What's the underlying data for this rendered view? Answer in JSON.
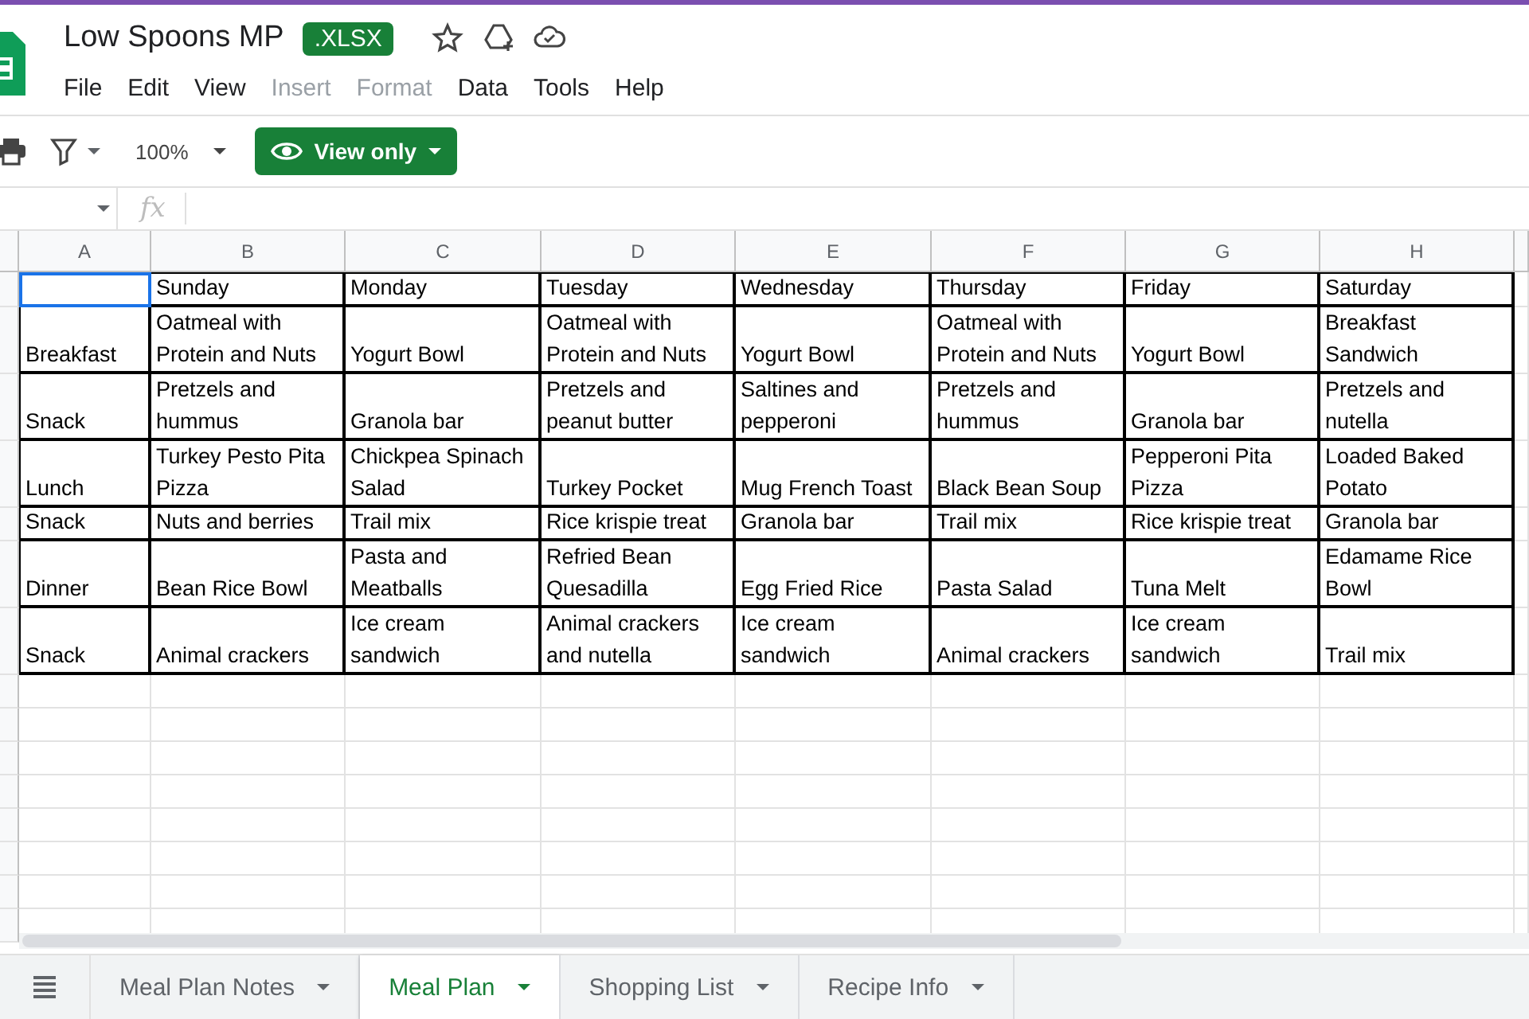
{
  "document": {
    "title": "Low Spoons MP",
    "file_badge": ".XLSX"
  },
  "menu": [
    {
      "label": "File",
      "disabled": false
    },
    {
      "label": "Edit",
      "disabled": false
    },
    {
      "label": "View",
      "disabled": false
    },
    {
      "label": "Insert",
      "disabled": true
    },
    {
      "label": "Format",
      "disabled": true
    },
    {
      "label": "Data",
      "disabled": false
    },
    {
      "label": "Tools",
      "disabled": false
    },
    {
      "label": "Help",
      "disabled": false
    }
  ],
  "toolbar": {
    "zoom": "100%",
    "mode_button": "View only"
  },
  "formula_bar": {
    "label": "fx"
  },
  "columns": [
    "A",
    "B",
    "C",
    "D",
    "E",
    "F",
    "G",
    "H"
  ],
  "header_row": {
    "corner_selected": true,
    "days": [
      "Sunday",
      "Monday",
      "Tuesday",
      "Wednesday",
      "Thursday",
      "Friday",
      "Saturday"
    ]
  },
  "meals": [
    {
      "meal": "Breakfast",
      "entries": [
        "Oatmeal with Protein and Nuts",
        "Yogurt Bowl",
        "Oatmeal with Protein and Nuts",
        "Yogurt Bowl",
        "Oatmeal with Protein and Nuts",
        "Yogurt Bowl",
        "Breakfast Sandwich"
      ]
    },
    {
      "meal": "Snack",
      "entries": [
        "Pretzels and hummus",
        "Granola bar",
        "Pretzels and peanut butter",
        "Saltines and pepperoni",
        "Pretzels and hummus",
        "Granola bar",
        "Pretzels and nutella"
      ]
    },
    {
      "meal": "Lunch",
      "entries": [
        "Turkey Pesto Pita Pizza",
        "Chickpea Spinach Salad",
        "Turkey Pocket",
        "Mug French Toast",
        "Black Bean Soup",
        "Pepperoni Pita Pizza",
        "Loaded Baked Potato"
      ]
    },
    {
      "meal": "Snack",
      "entries": [
        "Nuts and berries",
        "Trail mix",
        "Rice krispie treat",
        "Granola bar",
        "Trail mix",
        "Rice krispie treat",
        "Granola bar"
      ]
    },
    {
      "meal": "Dinner",
      "entries": [
        "Bean Rice Bowl",
        "Pasta and Meatballs",
        "Refried Bean Quesadilla",
        "Egg Fried Rice",
        "Pasta Salad",
        "Tuna Melt",
        "Edamame Rice Bowl"
      ]
    },
    {
      "meal": "Snack",
      "entries": [
        "Animal crackers",
        "Ice cream sandwich",
        "Animal crackers and nutella",
        "Ice cream sandwich",
        "Animal crackers",
        "Ice cream sandwich",
        "Trail mix"
      ]
    }
  ],
  "sheet_tabs": [
    {
      "label": "Meal Plan Notes",
      "selected": false
    },
    {
      "label": "Meal Plan",
      "selected": true
    },
    {
      "label": "Shopping List",
      "selected": false
    },
    {
      "label": "Recipe Info",
      "selected": false
    }
  ]
}
